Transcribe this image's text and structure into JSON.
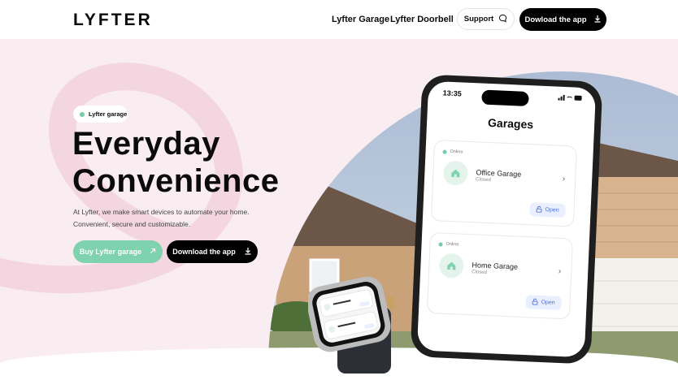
{
  "brand": {
    "logo": "LYFTER"
  },
  "nav": {
    "links": [
      "Lyfter Garage",
      "Lyfter Doorbell"
    ],
    "support_label": "Support",
    "download_label": "Dowload the app"
  },
  "hero": {
    "badge": "Lyfter garage",
    "title_line1": "Everyday",
    "title_line2": "Convenience",
    "description_line1": "At Lyfter, we make smart devices to automate your home.",
    "description_line2": "Convenient, secure and customizable.",
    "buy_label": "Buy Lyfter garage",
    "download_label": "Download the app"
  },
  "phone": {
    "time": "13:35",
    "screen_title": "Garages",
    "garages": [
      {
        "status": "Online",
        "name": "Office Garage",
        "state": "Closed",
        "action": "Open"
      },
      {
        "status": "Online",
        "name": "Home Garage",
        "state": "Closed",
        "action": "Open"
      }
    ]
  },
  "colors": {
    "accent": "#7ed2ad",
    "background": "#f9edf1",
    "open_button": "#e9efff"
  }
}
